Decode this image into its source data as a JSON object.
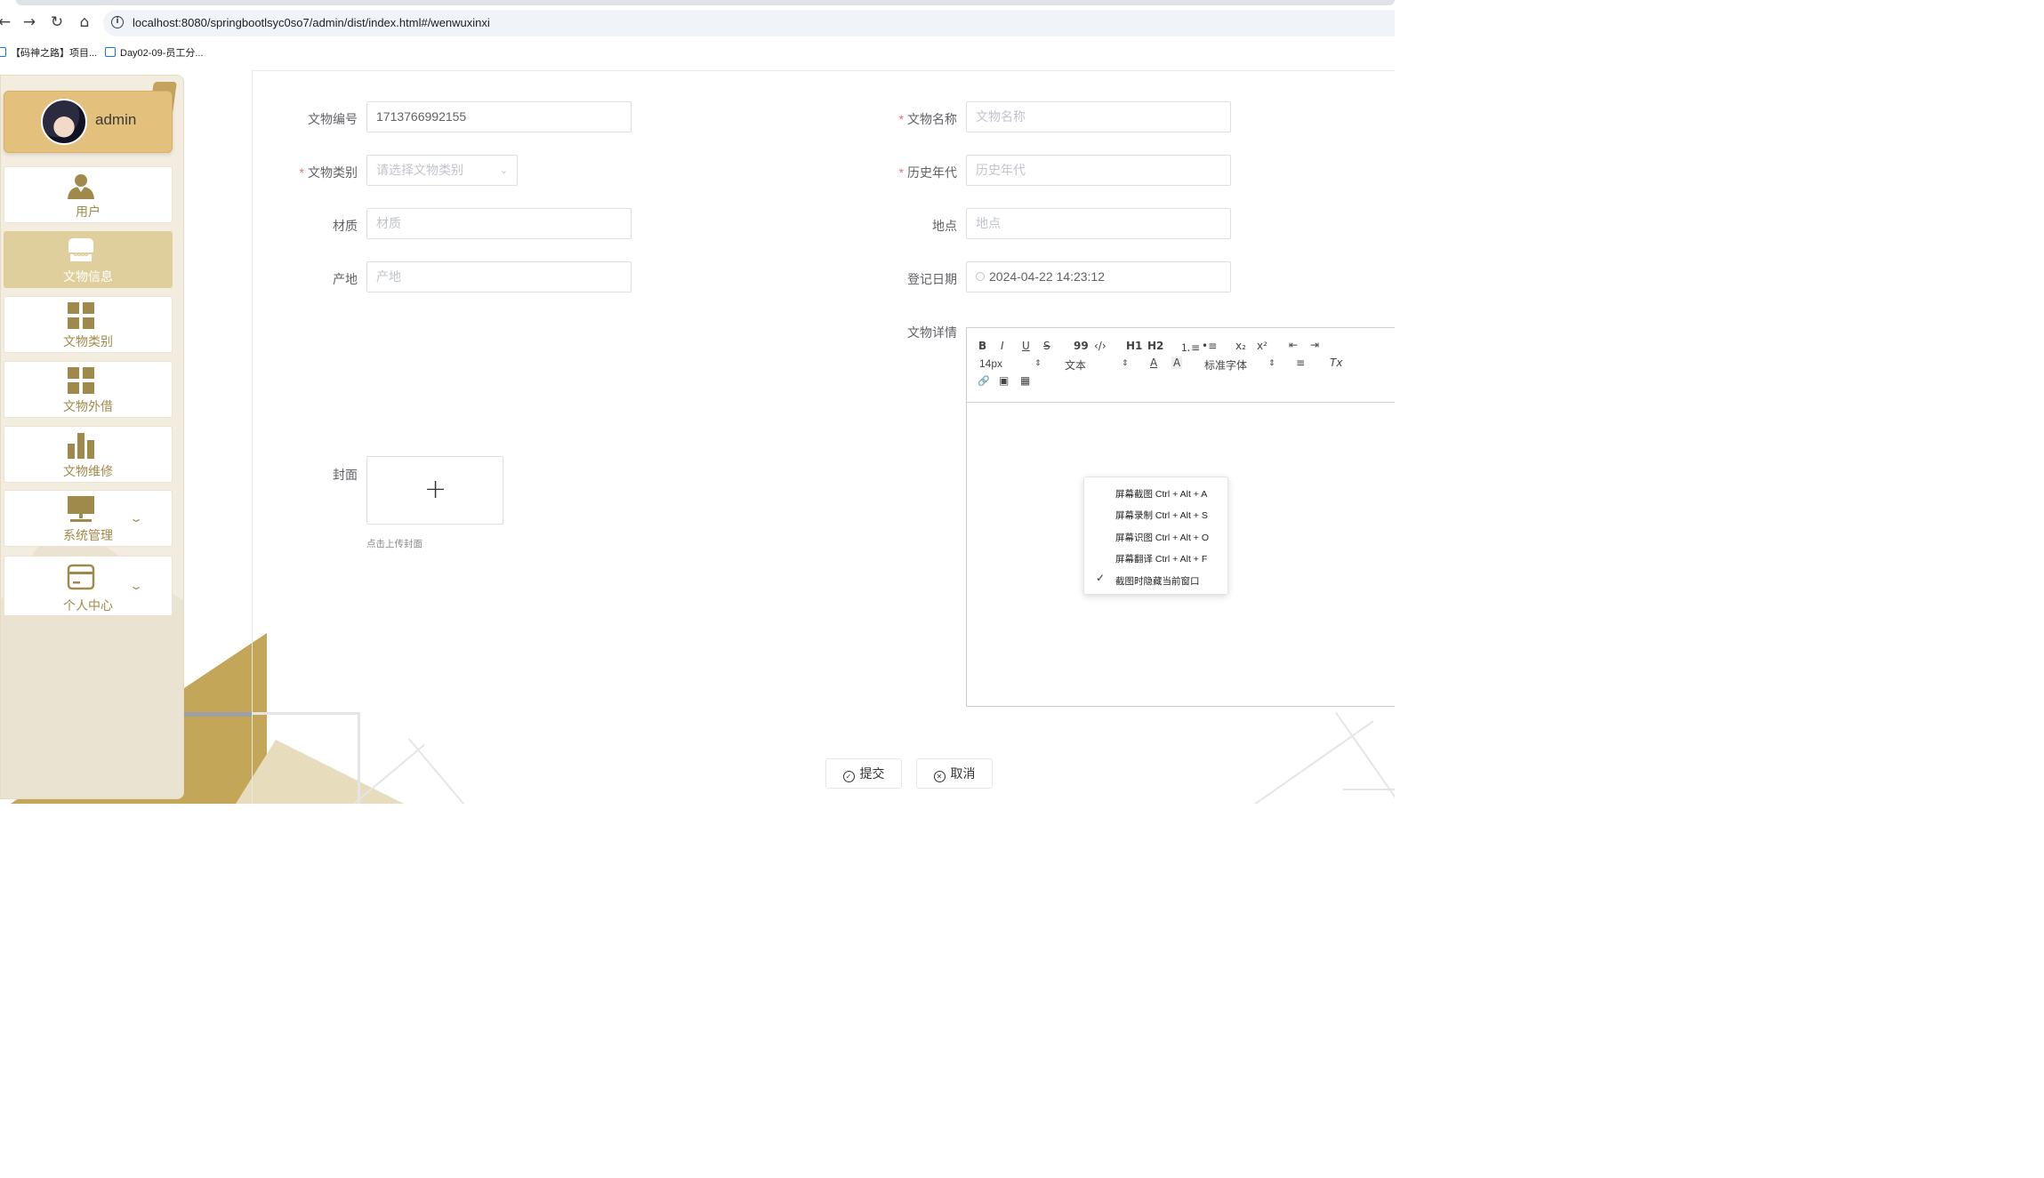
{
  "browser": {
    "url": "localhost:8080/springbootlsyc0so7/admin/dist/index.html#/wenwuxinxi",
    "bookmarks": [
      "【码神之路】项目...",
      "Day02-09-员工分..."
    ],
    "nav": {
      "back": "←",
      "forward": "→",
      "reload": "↻",
      "home": "⌂"
    }
  },
  "sidebar": {
    "user": {
      "name": "admin"
    },
    "items": [
      {
        "label": "用户",
        "icon": "user-icon"
      },
      {
        "label": "文物信息",
        "icon": "shop-icon",
        "active": true
      },
      {
        "label": "文物类别",
        "icon": "grid-icon"
      },
      {
        "label": "文物外借",
        "icon": "grid-icon"
      },
      {
        "label": "文物维修",
        "icon": "bar-chart-icon"
      },
      {
        "label": "系统管理",
        "icon": "monitor-icon",
        "expandable": true
      },
      {
        "label": "个人中心",
        "icon": "card-icon",
        "expandable": true
      }
    ],
    "arrow": "⌄"
  },
  "form": {
    "fields": {
      "code": {
        "label": "文物编号",
        "value": "1713766992155",
        "required": false
      },
      "name": {
        "label": "文物名称",
        "placeholder": "文物名称",
        "required": true
      },
      "category": {
        "label": "文物类别",
        "placeholder": "请选择文物类别",
        "required": true
      },
      "era": {
        "label": "历史年代",
        "placeholder": "历史年代",
        "required": true
      },
      "material": {
        "label": "材质",
        "placeholder": "材质"
      },
      "location": {
        "label": "地点",
        "placeholder": "地点"
      },
      "origin": {
        "label": "产地",
        "placeholder": "产地"
      },
      "date": {
        "label": "登记日期",
        "value": "2024-04-22 14:23:12"
      },
      "detail": {
        "label": "文物详情"
      },
      "cover": {
        "label": "封面",
        "tip": "点击上传封面",
        "plus": "+"
      }
    },
    "required_mark": "*",
    "submit_label": "提交",
    "cancel_label": "取消"
  },
  "editor": {
    "toolbar": {
      "bold": "B",
      "italic": "I",
      "underline": "U",
      "strike": "S",
      "quote": "99",
      "code": "‹/›",
      "h1": "H1",
      "h2": "H2",
      "ordered_list": "⒈≡",
      "bullet_list": "•≡",
      "sub": "x₂",
      "sup": "x²",
      "outdent": "⇤",
      "indent": "⇥",
      "size": "14px",
      "header": "文本",
      "color": "A",
      "background": "A",
      "font": "标准字体",
      "align": "≡",
      "clean": "Tx",
      "link": "🔗",
      "image": "▣",
      "video": "▦",
      "select_arrow": "⇕"
    }
  },
  "context_menu": {
    "items": [
      "屏幕截图 Ctrl + Alt + A",
      "屏幕录制 Ctrl + Alt + S",
      "屏幕识图 Ctrl + Alt + O",
      "屏幕翻译 Ctrl + Alt + F",
      "截图时隐藏当前窗口"
    ],
    "checked_index": 4,
    "check": "✓"
  },
  "colors": {
    "accent": "#c3a658",
    "sidebar_bg": "#f3ede0",
    "menu_active": "#dfcf9c",
    "menu_text": "#a08a4b",
    "required": "#f56c6c"
  }
}
